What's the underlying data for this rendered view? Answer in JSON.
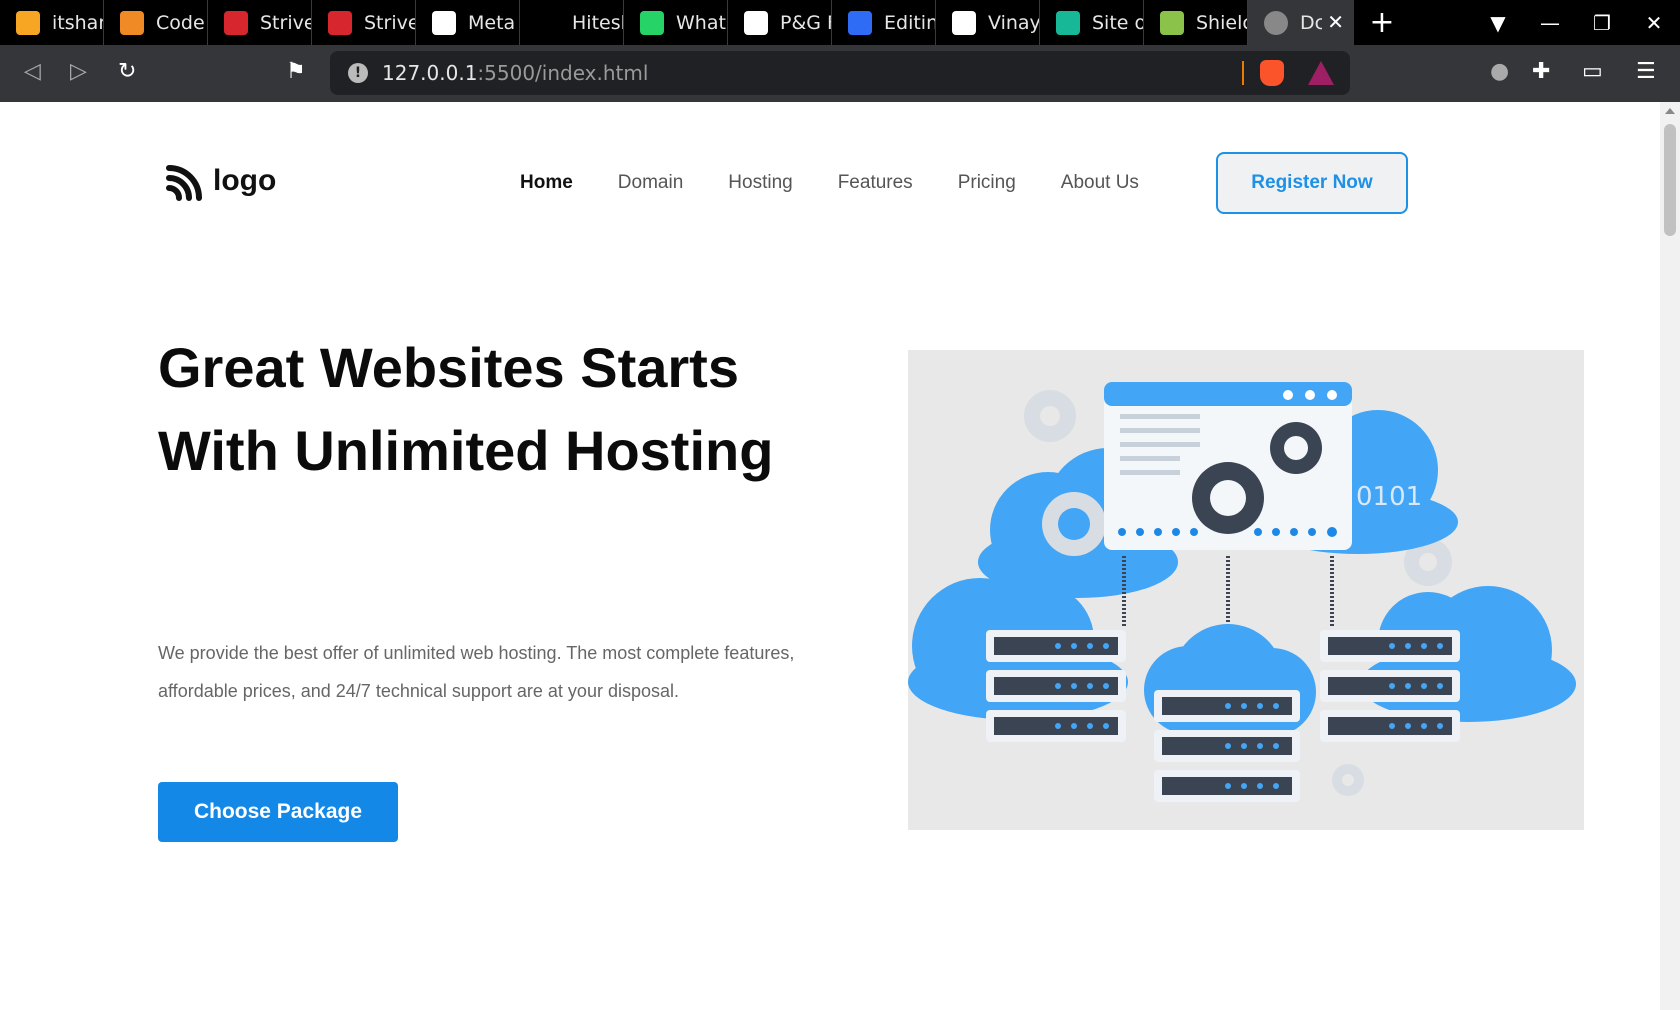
{
  "browser": {
    "tabs": [
      {
        "title": "itshar",
        "color": "#f6a623"
      },
      {
        "title": "Code",
        "color": "#f08a24"
      },
      {
        "title": "Strive",
        "color": "#d7262e"
      },
      {
        "title": "Strive",
        "color": "#d7262e"
      },
      {
        "title": "Meta",
        "color": "#ffffff"
      },
      {
        "title": "Hitesh",
        "color": "#000000"
      },
      {
        "title": "What",
        "color": "#25d366"
      },
      {
        "title": "P&G F",
        "color": "#ffffff"
      },
      {
        "title": "Editin",
        "color": "#2f6cf6"
      },
      {
        "title": "Vinay",
        "color": "#ffffff"
      },
      {
        "title": "Site o",
        "color": "#17b897"
      },
      {
        "title": "Shielc",
        "color": "#8bc34a"
      }
    ],
    "active_tab": {
      "title": "Dc"
    },
    "url_host": "127.0.0.1",
    "url_path": ":5500/index.html"
  },
  "page": {
    "logo_text": "logo",
    "nav": [
      "Home",
      "Domain",
      "Hosting",
      "Features",
      "Pricing",
      "About Us"
    ],
    "register_label": "Register Now",
    "hero_title": "Great Websites Starts With Unlimited Hosting",
    "hero_text": "We provide the best offer of unlimited web hosting. The most complete features, affordable prices, and 24/7 technical support are at your disposal.",
    "cta_label": "Choose Package",
    "illustration_text": "0101"
  },
  "colors": {
    "accent": "#1488e6",
    "cloud": "#42a5f5",
    "server": "#3a4452"
  }
}
